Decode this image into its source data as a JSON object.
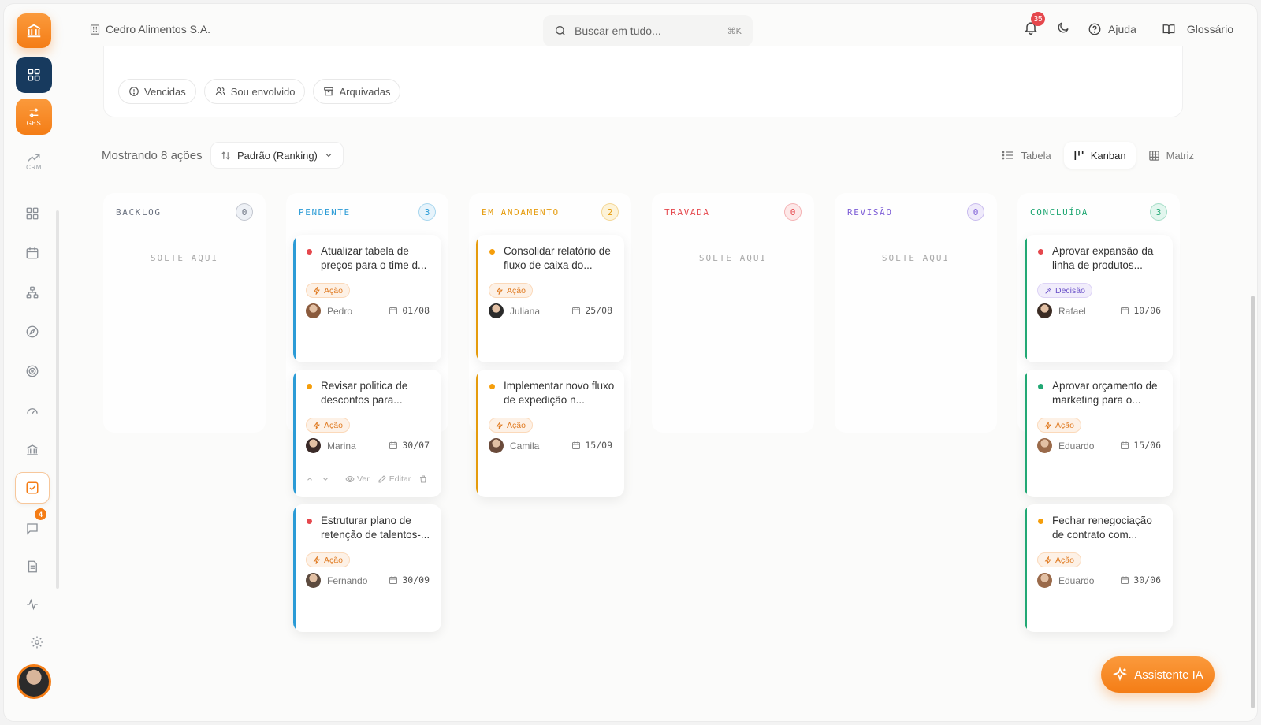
{
  "company": {
    "name": "Cedro Alimentos S.A."
  },
  "search": {
    "placeholder": "Buscar em tudo...",
    "shortcut": "⌘K"
  },
  "topbar": {
    "notifications": "35",
    "help": "Ajuda",
    "glossary": "Glossário"
  },
  "sidebar": {
    "ges_label": "GES",
    "crm_label": "CRM",
    "messages_badge": "4",
    "items": [
      "grid-icon",
      "calendar-icon",
      "org-chart-icon",
      "compass-icon",
      "target-icon",
      "gauge-icon",
      "bank-icon",
      "checkbox-icon",
      "chat-icon",
      "document-icon",
      "activity-icon",
      "settings-icon"
    ]
  },
  "filters": {
    "chips": [
      "Vencidas",
      "Sou envolvido",
      "Arquivadas"
    ]
  },
  "toolbar": {
    "count_prefix": "Mostrando",
    "count_value": "8",
    "count_suffix": "ações",
    "sort_label": "Padrão (Ranking)",
    "views": [
      "Tabela",
      "Kanban",
      "Matriz"
    ],
    "active_view": "Kanban"
  },
  "drop_label": "SOLTE AQUI",
  "columns": [
    {
      "title": "BACKLOG",
      "count": "0",
      "color": "#6b7280"
    },
    {
      "title": "PENDENTE",
      "count": "3",
      "color": "#2b9bd6"
    },
    {
      "title": "EM ANDAMENTO",
      "count": "2",
      "color": "#e59b0c"
    },
    {
      "title": "TRAVADA",
      "count": "0",
      "color": "#e5484d"
    },
    {
      "title": "REVISÃO",
      "count": "0",
      "color": "#7c5cd6"
    },
    {
      "title": "CONCLUÍDA",
      "count": "3",
      "color": "#22a874"
    }
  ],
  "cards": {
    "pendente": [
      {
        "title": "Atualizar tabela de preços para o time d...",
        "tag": "Ação",
        "owner": "Pedro",
        "due": "01/08",
        "priority": "#e5484d"
      },
      {
        "title": "Revisar politica de descontos para...",
        "tag": "Ação",
        "owner": "Marina",
        "due": "30/07",
        "priority": "#f59e0b",
        "actions": {
          "view": "Ver",
          "edit": "Editar"
        }
      },
      {
        "title": "Estruturar plano de retenção de talentos-...",
        "tag": "Ação",
        "owner": "Fernando",
        "due": "30/09",
        "priority": "#e5484d"
      }
    ],
    "andamento": [
      {
        "title": "Consolidar relatório de fluxo de caixa do...",
        "tag": "Ação",
        "owner": "Juliana",
        "due": "25/08",
        "priority": "#f59e0b"
      },
      {
        "title": "Implementar novo fluxo de expedição n...",
        "tag": "Ação",
        "owner": "Camila",
        "due": "15/09",
        "priority": "#f59e0b"
      }
    ],
    "concluida": [
      {
        "title": "Aprovar expansão da linha de produtos...",
        "tag": "Decisão",
        "owner": "Rafael",
        "due": "10/06",
        "priority": "#e5484d"
      },
      {
        "title": "Aprovar orçamento de marketing para o...",
        "tag": "Ação",
        "owner": "Eduardo",
        "due": "15/06",
        "priority": "#22a874"
      },
      {
        "title": "Fechar renegociação de contrato com...",
        "tag": "Ação",
        "owner": "Eduardo",
        "due": "30/06",
        "priority": "#f59e0b"
      }
    ]
  },
  "assistant": {
    "label": "Assistente IA"
  },
  "colors": {
    "accent": "#f47d16",
    "navy": "#173a5e"
  }
}
